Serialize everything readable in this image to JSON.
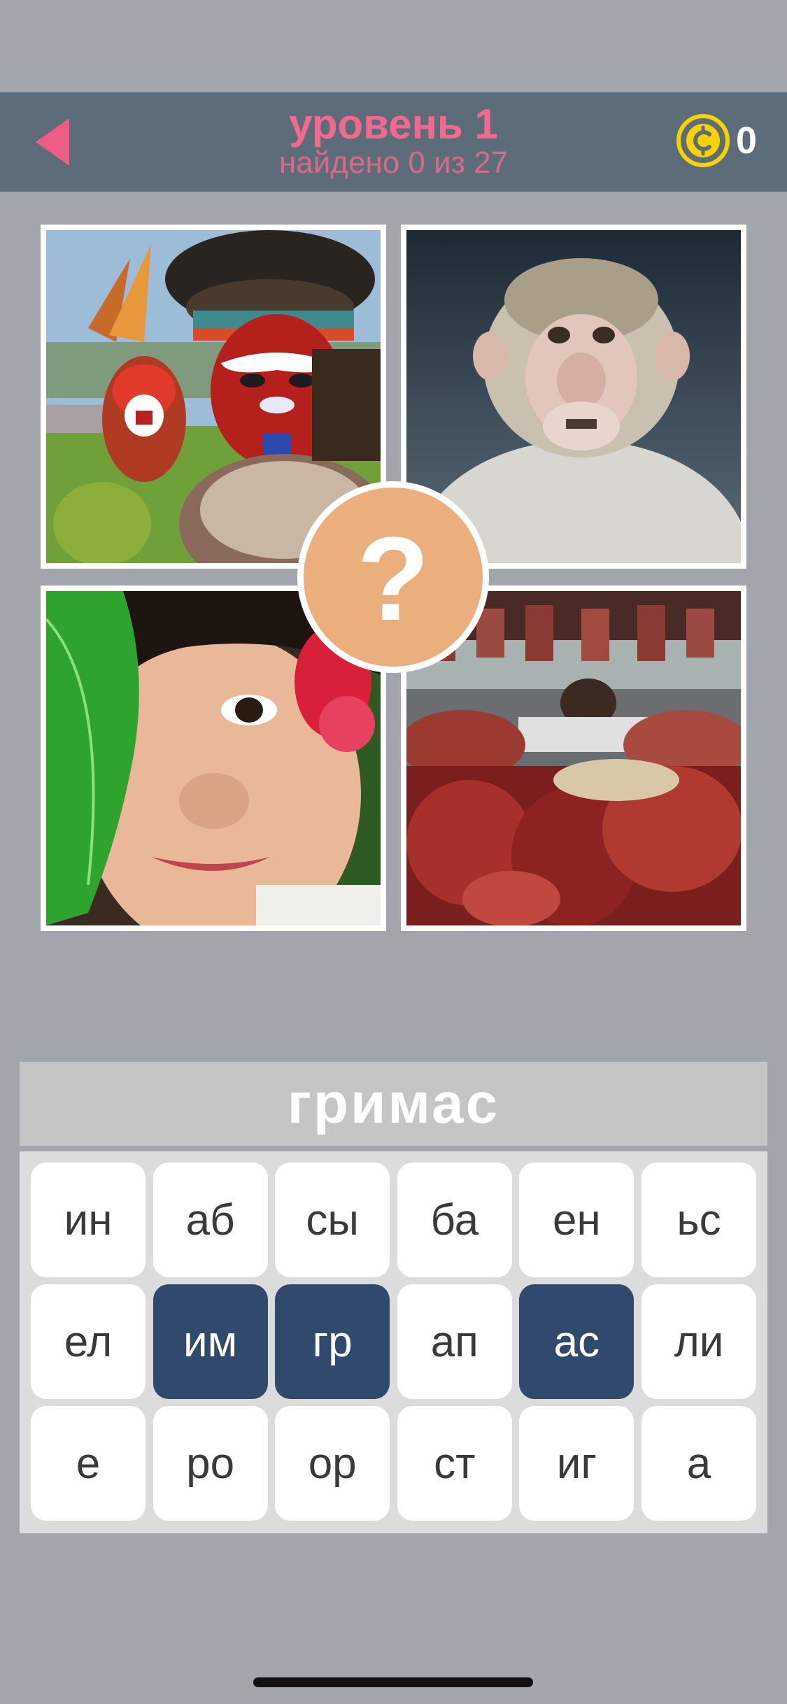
{
  "header": {
    "level_title": "уровень 1",
    "found_text": "найдено 0 из 27",
    "coins": "0",
    "icons": {
      "back": "back-arrow-icon",
      "coin": "coin-icon"
    },
    "colors": {
      "bar": "#5d6c79",
      "title": "#f2688e",
      "back_arrow": "#ef5d86",
      "coin": "#f6d300"
    }
  },
  "hint": {
    "label": "?",
    "color": "#eaaf7c"
  },
  "answer": {
    "text": "гримас"
  },
  "keyboard": {
    "rows": [
      [
        {
          "label": "ин",
          "used": false
        },
        {
          "label": "аб",
          "used": false
        },
        {
          "label": "сы",
          "used": false
        },
        {
          "label": "ба",
          "used": false
        },
        {
          "label": "ен",
          "used": false
        },
        {
          "label": "ьс",
          "used": false
        }
      ],
      [
        {
          "label": "ел",
          "used": false
        },
        {
          "label": "им",
          "used": true
        },
        {
          "label": "гр",
          "used": true
        },
        {
          "label": "ап",
          "used": false
        },
        {
          "label": "ас",
          "used": true
        },
        {
          "label": "ли",
          "used": false
        }
      ],
      [
        {
          "label": "е",
          "used": false
        },
        {
          "label": "ро",
          "used": false
        },
        {
          "label": "ор",
          "used": false
        },
        {
          "label": "ст",
          "used": false
        },
        {
          "label": "иг",
          "used": false
        },
        {
          "label": "а",
          "used": false
        }
      ]
    ],
    "used_color": "#30496c"
  }
}
